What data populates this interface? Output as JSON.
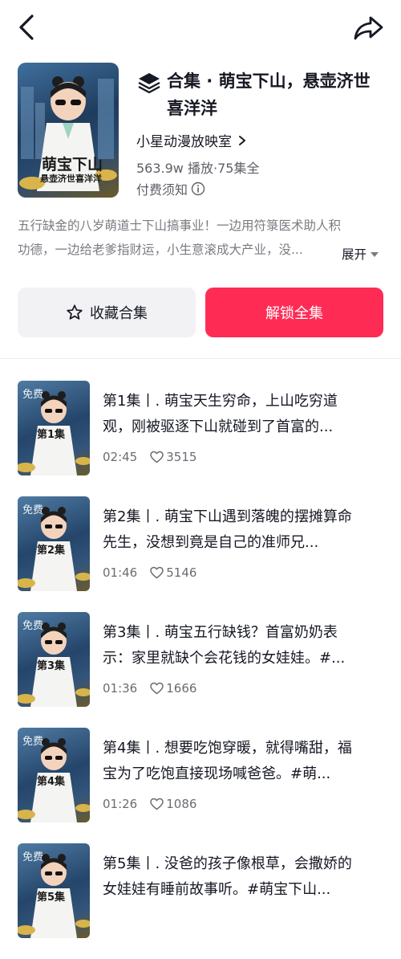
{
  "header": {
    "title": "合集 · 萌宝下山，悬壶济世喜洋洋",
    "author": "小星动漫放映室",
    "plays": "563.9w 播放",
    "dot": " · ",
    "episodes": "75集全",
    "notice": "付费须知",
    "cover_text_main": "萌宝下山",
    "cover_text_sub": "悬壶济世喜洋洋"
  },
  "description": {
    "line1": "五行缺金的八岁萌道士下山搞事业！一边用符箓医术助人积",
    "line2": "功德，一边给老爹指财运，小生意滚成大产业，没...",
    "expand_label": "展开"
  },
  "buttons": {
    "collect": "收藏合集",
    "unlock": "解锁全集"
  },
  "episodes": [
    {
      "title": "第1集丨. 萌宝天生穷命，上山吃穷道观，刚被驱逐下山就碰到了首富的...",
      "duration": "02:45",
      "likes": "3515",
      "badge": "免费",
      "thumb_label": "第1集"
    },
    {
      "title": "第2集丨. 萌宝下山遇到落魄的摆摊算命先生，没想到竟是自己的准师兄...",
      "duration": "01:46",
      "likes": "5146",
      "badge": "免费",
      "thumb_label": "第2集"
    },
    {
      "title": "第3集丨. 萌宝五行缺钱？首富奶奶表示：家里就缺个会花钱的女娃娃。#...",
      "duration": "01:36",
      "likes": "1666",
      "badge": "免费",
      "thumb_label": "第3集"
    },
    {
      "title": "第4集丨. 想要吃饱穿暖，就得嘴甜，福宝为了吃饱直接现场喊爸爸。#萌...",
      "duration": "01:26",
      "likes": "1086",
      "badge": "免费",
      "thumb_label": "第4集"
    },
    {
      "title": "第5集丨. 没爸的孩子像根草，会撒娇的女娃娃有睡前故事听。#萌宝下山...",
      "duration": "",
      "likes": "",
      "badge": "免费",
      "thumb_label": "第5集"
    }
  ],
  "colors": {
    "accent": "#fe2c55",
    "text": "#161823",
    "secondary": "#7a7b82",
    "button_bg": "#f2f2f4"
  },
  "icons": {
    "back": "back-arrow-icon",
    "share": "share-arrow-icon",
    "collection": "stack-layers-icon",
    "star": "star-icon",
    "heart": "heart-icon",
    "info": "info-icon"
  }
}
